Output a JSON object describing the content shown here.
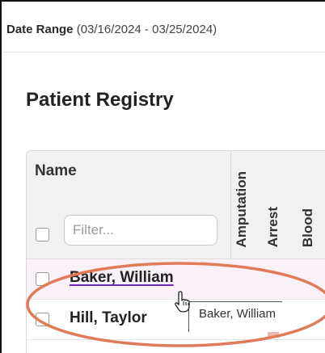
{
  "header": {
    "date_range_label": "Date Range",
    "date_range_value": "(03/16/2024 - 03/25/2024)"
  },
  "page": {
    "title": "Patient Registry"
  },
  "grid": {
    "name_column": "Name",
    "filter_placeholder": "Filter...",
    "vertical_columns": [
      "Amputation",
      "Arrest",
      "Blood"
    ],
    "rows": [
      {
        "name": "Baker, William"
      },
      {
        "name": "Hill, Taylor"
      }
    ]
  },
  "tooltip": {
    "text": "Baker, William"
  },
  "colors": {
    "annotation_ellipse": "#e07a58",
    "link_underline": "#6b2bb0",
    "row_highlight": "#f9f1f7",
    "header_bg": "#f1f1f3"
  }
}
